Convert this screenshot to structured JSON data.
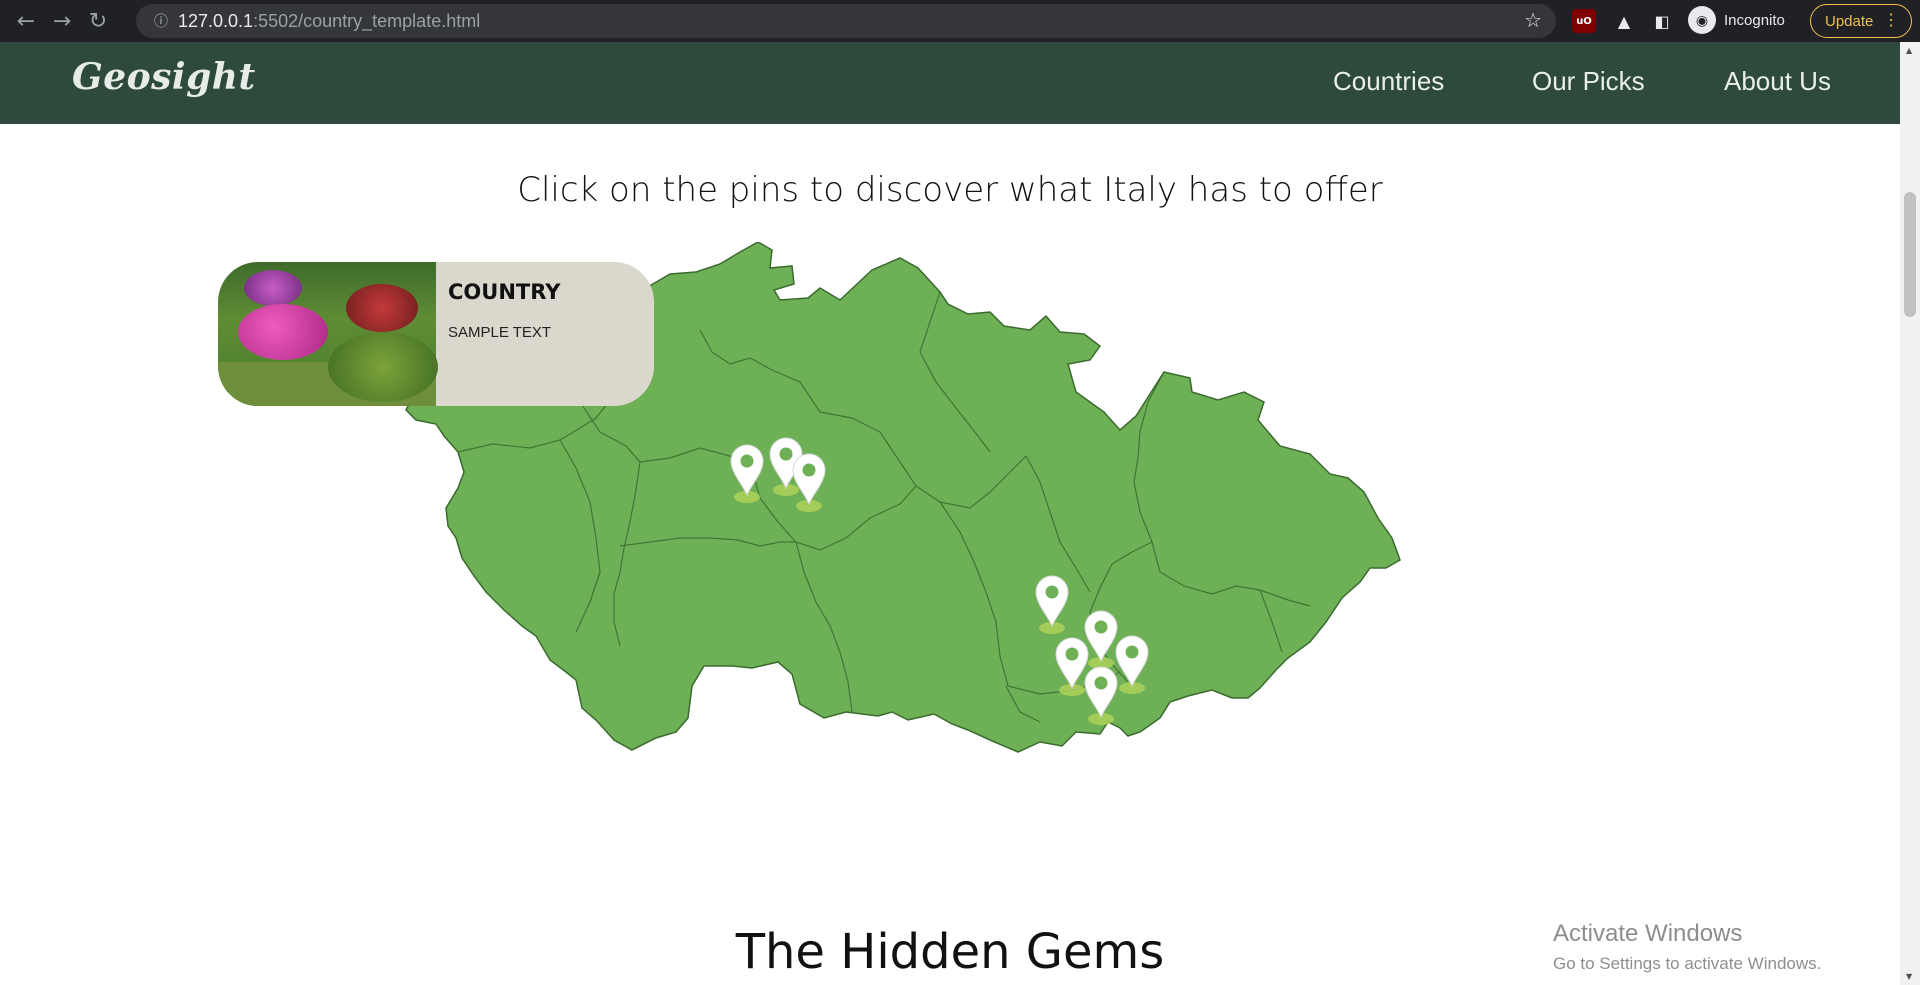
{
  "browser": {
    "url_host": "127.0.0.1",
    "url_path": ":5502/country_template.html",
    "profile_label": "Incognito",
    "update_label": "Update",
    "ublock_label": "uO"
  },
  "site": {
    "logo_text": "Geosight",
    "nav": [
      "Countries",
      "Our Picks",
      "About Us"
    ]
  },
  "main": {
    "headline": "Click on the pins to discover what Italy has to offer",
    "popup": {
      "title": "COUNTRY",
      "body": "SAMPLE TEXT"
    },
    "section_title": "The Hidden Gems"
  },
  "map": {
    "fill_color": "#6eb056",
    "border_color": "#3a6b2e",
    "pin_color": "#ffffff",
    "pin_accent": "#6eb056",
    "pin_count": 8
  },
  "os_watermark": {
    "line1": "Activate Windows",
    "line2": "Go to Settings to activate Windows."
  }
}
